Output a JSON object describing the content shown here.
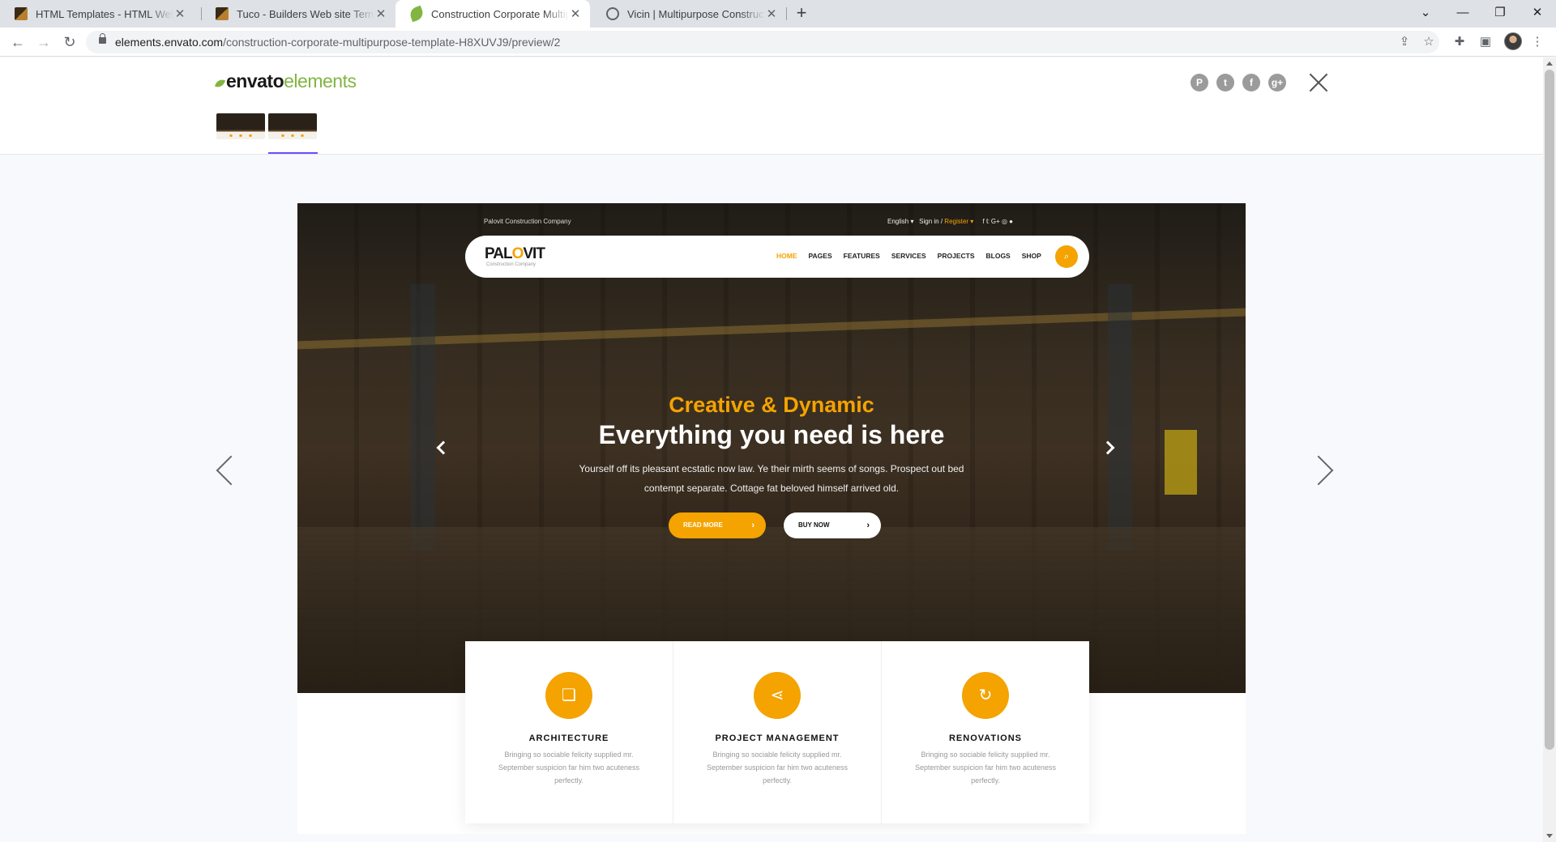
{
  "browser": {
    "tabs": [
      {
        "title": "HTML Templates - HTML Website Templates",
        "active": false
      },
      {
        "title": "Tuco - Builders Web site Template",
        "active": false
      },
      {
        "title": "Construction Corporate Multipurpose",
        "active": true
      },
      {
        "title": "Vicin | Multipurpose Construction",
        "active": false
      }
    ],
    "url_domain": "elements.envato.com",
    "url_path": "/construction-corporate-multipurpose-template-H8XUVJ9/preview/2"
  },
  "envato": {
    "logo_bold": "envato",
    "logo_light": "elements",
    "share_icons": [
      "pinterest-icon",
      "twitter-icon",
      "facebook-icon",
      "google-plus-icon"
    ]
  },
  "preview": {
    "topbar_left": "Palovit Construction Company",
    "topbar_right": {
      "language": "English ▾",
      "signin": "Sign in /",
      "register": "Register ▾",
      "social": "f  𝕥  G+  ◎  ●"
    },
    "logo": {
      "pal": "PAL",
      "o": "O",
      "vit": "VIT",
      "sub": "Construction Company"
    },
    "nav": [
      "HOME",
      "PAGES",
      "FEATURES",
      "SERVICES",
      "PROJECTS",
      "BLOGS",
      "SHOP"
    ],
    "hero": {
      "subtitle": "Creative & Dynamic",
      "title": "Everything you need is here",
      "text": "Yourself off its pleasant ecstatic now law. Ye their mirth seems of songs. Prospect out bed contempt separate. Cottage fat beloved himself arrived old.",
      "btn_read": "READ MORE",
      "btn_buy": "BUY NOW"
    },
    "services": [
      {
        "title": "ARCHITECTURE",
        "text": "Bringing so sociable felicity supplied mr. September suspicion far him two acuteness perfectly.",
        "icon": "bookmark-icon"
      },
      {
        "title": "PROJECT MANAGEMENT",
        "text": "Bringing so sociable felicity supplied mr. September suspicion far him two acuteness perfectly.",
        "icon": "share-icon"
      },
      {
        "title": "RENOVATIONS",
        "text": "Bringing so sociable felicity supplied mr. September suspicion far him two acuteness perfectly.",
        "icon": "refresh-icon"
      }
    ]
  },
  "colors": {
    "accent": "#f4a300",
    "envato_green": "#82b541",
    "tab_strip": "#dee1e6"
  }
}
